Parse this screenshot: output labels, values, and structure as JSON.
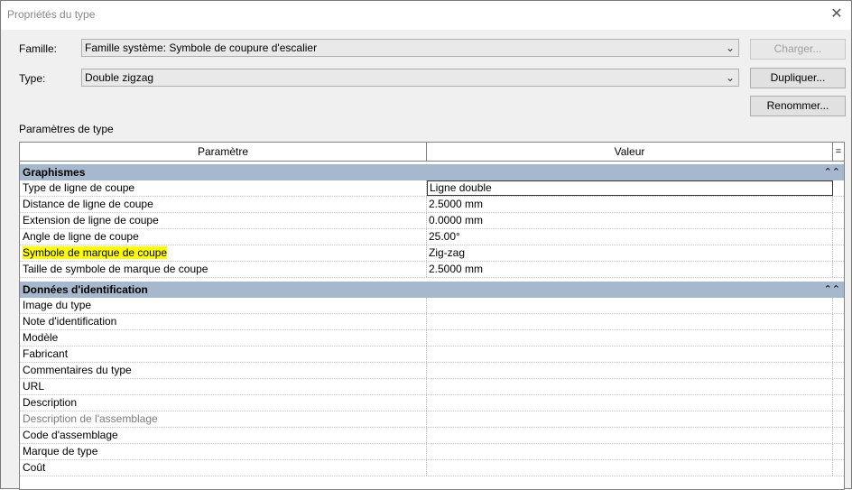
{
  "window": {
    "title": "Propriétés du type",
    "close_glyph": "✕"
  },
  "famille": {
    "label": "Famille:",
    "value": "Famille système: Symbole de coupure d'escalier"
  },
  "type": {
    "label": "Type:",
    "value": "Double zigzag"
  },
  "buttons": {
    "charger": "Charger...",
    "dupliquer": "Dupliquer...",
    "renommer": "Renommer..."
  },
  "section_label": "Paramètres de type",
  "grid": {
    "col_param": "Paramètre",
    "col_value": "Valeur",
    "col_extra": "=",
    "groups": [
      {
        "name": "Graphismes",
        "rows": [
          {
            "param": "Type de ligne de coupe",
            "value": "Ligne double"
          },
          {
            "param": "Distance de ligne de coupe",
            "value": "2.5000 mm"
          },
          {
            "param": "Extension de ligne de coupe",
            "value": "0.0000 mm"
          },
          {
            "param": "Angle de ligne de coupe",
            "value": "25.00°"
          },
          {
            "param": "Symbole de marque de coupe",
            "value": "Zig-zag"
          },
          {
            "param": "Taille de symbole de marque de coupe",
            "value": "2.5000 mm"
          }
        ]
      },
      {
        "name": "Données d'identification",
        "rows": [
          {
            "param": "Image du type",
            "value": ""
          },
          {
            "param": "Note d'identification",
            "value": ""
          },
          {
            "param": "Modèle",
            "value": ""
          },
          {
            "param": "Fabricant",
            "value": ""
          },
          {
            "param": "Commentaires du type",
            "value": ""
          },
          {
            "param": "URL",
            "value": ""
          },
          {
            "param": "Description",
            "value": ""
          },
          {
            "param": "Description de l'assemblage",
            "value": ""
          },
          {
            "param": "Code d'assemblage",
            "value": ""
          },
          {
            "param": "Marque de type",
            "value": ""
          },
          {
            "param": "Coût",
            "value": ""
          }
        ]
      }
    ]
  },
  "colors": {
    "group_header": "#a5b8cd",
    "highlight": "#ffff00"
  },
  "icons": {
    "combo_arrow": "chevron-down-icon",
    "group_toggle": "collapse-chevron-icon"
  }
}
